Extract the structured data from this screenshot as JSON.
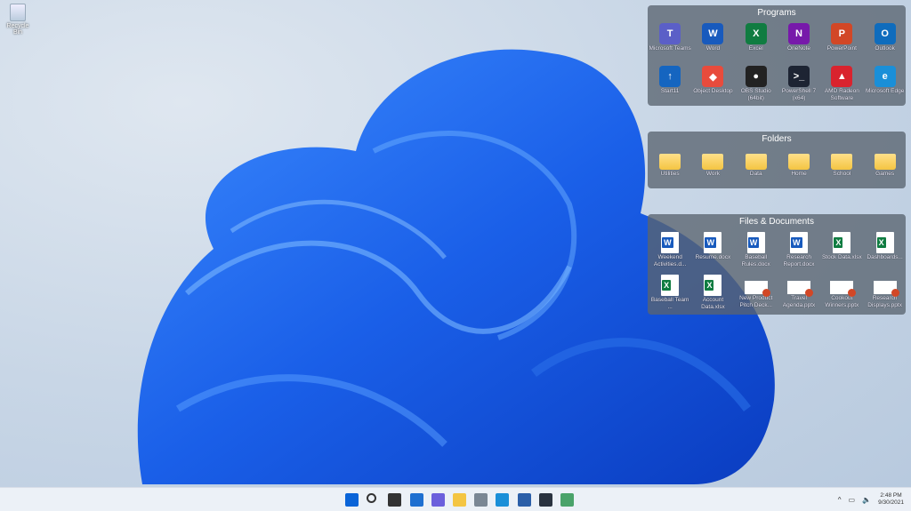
{
  "desktop": {
    "recycle_bin": "Recycle Bin"
  },
  "panels": [
    {
      "title": "Programs",
      "items": [
        {
          "label": "Microsoft Teams",
          "icon": "teams-icon",
          "color": "#5b5fc7",
          "glyph": "T"
        },
        {
          "label": "Word",
          "icon": "word-icon",
          "color": "#185abd",
          "glyph": "W"
        },
        {
          "label": "Excel",
          "icon": "excel-icon",
          "color": "#107c41",
          "glyph": "X"
        },
        {
          "label": "OneNote",
          "icon": "onenote-icon",
          "color": "#7719aa",
          "glyph": "N"
        },
        {
          "label": "PowerPoint",
          "icon": "powerpoint-icon",
          "color": "#d24726",
          "glyph": "P"
        },
        {
          "label": "Outlook",
          "icon": "outlook-icon",
          "color": "#0f6cbd",
          "glyph": "O"
        },
        {
          "label": "Start11",
          "icon": "start11-icon",
          "color": "#1565c0",
          "glyph": "↑"
        },
        {
          "label": "Object Desktop",
          "icon": "object-desktop-icon",
          "color": "#e84b3c",
          "glyph": "◆"
        },
        {
          "label": "OBS Studio (64bit)",
          "icon": "obs-icon",
          "color": "#222",
          "glyph": "●"
        },
        {
          "label": "PowerShell 7 (x64)",
          "icon": "powershell-icon",
          "color": "#1d2433",
          "glyph": ">_"
        },
        {
          "label": "AMD Radeon Software",
          "icon": "amd-radeon-icon",
          "color": "#d9232e",
          "glyph": "▲"
        },
        {
          "label": "Microsoft Edge",
          "icon": "edge-icon",
          "color": "#1a8fd8",
          "glyph": "e"
        }
      ]
    },
    {
      "title": "Folders",
      "items": [
        {
          "label": "Utilities",
          "icon": "folder-icon"
        },
        {
          "label": "Work",
          "icon": "folder-icon"
        },
        {
          "label": "Data",
          "icon": "folder-icon"
        },
        {
          "label": "Home",
          "icon": "folder-icon"
        },
        {
          "label": "School",
          "icon": "folder-icon"
        },
        {
          "label": "Games",
          "icon": "folder-icon"
        }
      ]
    },
    {
      "title": "Files & Documents",
      "items": [
        {
          "label": "Weekend Activities.d...",
          "icon": "word-doc-icon",
          "color": "#185abd",
          "glyph": "W"
        },
        {
          "label": "Resume.docx",
          "icon": "word-doc-icon",
          "color": "#185abd",
          "glyph": "W"
        },
        {
          "label": "Baseball Rules.docx",
          "icon": "word-doc-icon",
          "color": "#185abd",
          "glyph": "W"
        },
        {
          "label": "Research Report.docx",
          "icon": "word-doc-icon",
          "color": "#185abd",
          "glyph": "W"
        },
        {
          "label": "Stock Data.xlsx",
          "icon": "excel-doc-icon",
          "color": "#107c41",
          "glyph": "X"
        },
        {
          "label": "Dashboards...",
          "icon": "excel-doc-icon",
          "color": "#107c41",
          "glyph": "X"
        },
        {
          "label": "Baseball Team ...",
          "icon": "excel-doc-icon",
          "color": "#107c41",
          "glyph": "X"
        },
        {
          "label": "Account Data.xlsx",
          "icon": "excel-doc-icon",
          "color": "#107c41",
          "glyph": "X"
        },
        {
          "label": "New Product Pitch Deck...",
          "icon": "pptx-doc-icon"
        },
        {
          "label": "Travel Agenda.pptx",
          "icon": "pptx-doc-icon"
        },
        {
          "label": "Cookout Winners.pptx",
          "icon": "pptx-doc-icon"
        },
        {
          "label": "Research Displays.pptx",
          "icon": "pptx-doc-icon"
        }
      ]
    }
  ],
  "taskbar": {
    "items": [
      {
        "name": "start-button",
        "icon": "windows-icon",
        "color": "#0a64d8"
      },
      {
        "name": "search-button",
        "icon": "search-icon",
        "color": "transparent"
      },
      {
        "name": "task-view-button",
        "icon": "task-view-icon",
        "color": "#333"
      },
      {
        "name": "widgets-button",
        "icon": "widgets-icon",
        "color": "#1e6fd0"
      },
      {
        "name": "chat-button",
        "icon": "chat-icon",
        "color": "#6b5fdc"
      },
      {
        "name": "file-explorer-button",
        "icon": "folder-icon",
        "color": "#f4c542"
      },
      {
        "name": "camera-button",
        "icon": "camera-icon",
        "color": "#7a8794"
      },
      {
        "name": "edge-button",
        "icon": "edge-icon",
        "color": "#1a8fd8"
      },
      {
        "name": "store-button",
        "icon": "store-icon",
        "color": "#2b5fa8"
      },
      {
        "name": "fences-button",
        "icon": "fences-icon",
        "color": "#2a3340"
      },
      {
        "name": "globe-app-button",
        "icon": "globe-icon",
        "color": "#4aa36a"
      }
    ],
    "time": "2:48 PM",
    "date": "9/30/2021"
  }
}
